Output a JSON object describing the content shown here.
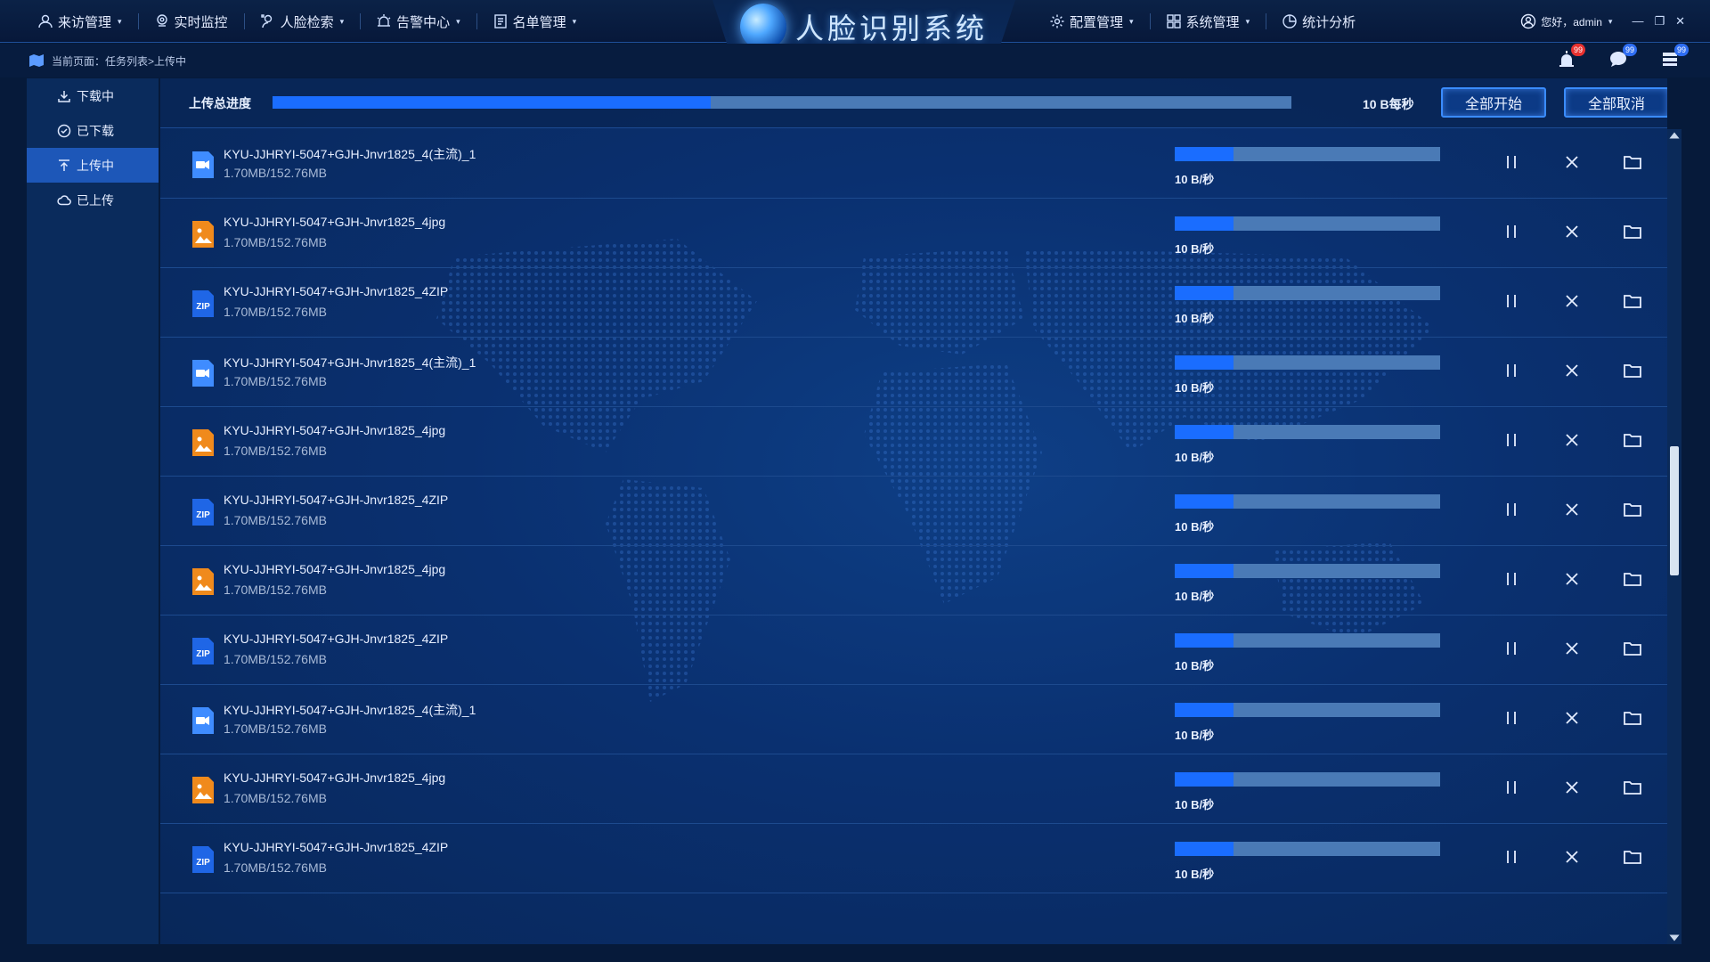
{
  "nav": {
    "left": [
      {
        "label": "来访管理",
        "icon": "user-icon",
        "caret": true
      },
      {
        "label": "实时监控",
        "icon": "location-icon",
        "caret": false
      },
      {
        "label": "人脸检索",
        "icon": "face-search-icon",
        "caret": true
      },
      {
        "label": "告警中心",
        "icon": "alarm-icon",
        "caret": true
      },
      {
        "label": "名单管理",
        "icon": "list-icon",
        "caret": true
      }
    ],
    "right": [
      {
        "label": "配置管理",
        "icon": "gear-icon",
        "caret": true
      },
      {
        "label": "系统管理",
        "icon": "grid-icon",
        "caret": true
      },
      {
        "label": "统计分析",
        "icon": "pie-icon",
        "caret": false
      }
    ],
    "brand_title": "人脸识别系统",
    "user_greeting": "您好，admin",
    "caret_char": "▾",
    "window_controls": {
      "minimize": "—",
      "restore": "❐",
      "close": "✕"
    }
  },
  "breadcrumb": {
    "text": "当前页面：任务列表>上传中"
  },
  "tool_badges": {
    "alarm": "99",
    "message": "99",
    "task": "99"
  },
  "sidebar": {
    "items": [
      {
        "label": "下载中",
        "icon": "download-icon",
        "active": false
      },
      {
        "label": "已下载",
        "icon": "check-circle-icon",
        "active": false
      },
      {
        "label": "上传中",
        "icon": "upload-icon",
        "active": true
      },
      {
        "label": "已上传",
        "icon": "cloud-icon",
        "active": false
      }
    ]
  },
  "upload_total": {
    "label": "上传总进度",
    "progress_percent": 43,
    "speed": "10 B每秒",
    "start_all": "全部开始",
    "cancel_all": "全部取消"
  },
  "files": [
    {
      "name": "KYU-JJHRYI-5047+GJH-Jnvr1825_4(主流)_1",
      "size": "1.70MB/152.76MB",
      "type": "video",
      "progress_percent": 22,
      "speed": "10 B/秒"
    },
    {
      "name": "KYU-JJHRYI-5047+GJH-Jnvr1825_4jpg",
      "size": "1.70MB/152.76MB",
      "type": "image",
      "progress_percent": 22,
      "speed": "10 B/秒"
    },
    {
      "name": "KYU-JJHRYI-5047+GJH-Jnvr1825_4ZIP",
      "size": "1.70MB/152.76MB",
      "type": "zip",
      "progress_percent": 22,
      "speed": "10 B/秒"
    },
    {
      "name": "KYU-JJHRYI-5047+GJH-Jnvr1825_4(主流)_1",
      "size": "1.70MB/152.76MB",
      "type": "video",
      "progress_percent": 22,
      "speed": "10 B/秒"
    },
    {
      "name": "KYU-JJHRYI-5047+GJH-Jnvr1825_4jpg",
      "size": "1.70MB/152.76MB",
      "type": "image",
      "progress_percent": 22,
      "speed": "10 B/秒"
    },
    {
      "name": "KYU-JJHRYI-5047+GJH-Jnvr1825_4ZIP",
      "size": "1.70MB/152.76MB",
      "type": "zip",
      "progress_percent": 22,
      "speed": "10 B/秒"
    },
    {
      "name": "KYU-JJHRYI-5047+GJH-Jnvr1825_4jpg",
      "size": "1.70MB/152.76MB",
      "type": "image",
      "progress_percent": 22,
      "speed": "10 B/秒"
    },
    {
      "name": "KYU-JJHRYI-5047+GJH-Jnvr1825_4ZIP",
      "size": "1.70MB/152.76MB",
      "type": "zip",
      "progress_percent": 22,
      "speed": "10 B/秒"
    },
    {
      "name": "KYU-JJHRYI-5047+GJH-Jnvr1825_4(主流)_1",
      "size": "1.70MB/152.76MB",
      "type": "video",
      "progress_percent": 22,
      "speed": "10 B/秒"
    },
    {
      "name": "KYU-JJHRYI-5047+GJH-Jnvr1825_4jpg",
      "size": "1.70MB/152.76MB",
      "type": "image",
      "progress_percent": 22,
      "speed": "10 B/秒"
    },
    {
      "name": "KYU-JJHRYI-5047+GJH-Jnvr1825_4ZIP",
      "size": "1.70MB/152.76MB",
      "type": "zip",
      "progress_percent": 22,
      "speed": "10 B/秒"
    }
  ],
  "icons": {
    "zip_label": "ZIP"
  },
  "colors": {
    "accent": "#1a6dff",
    "video_icon": "#3f8cff",
    "image_icon": "#f08a1c",
    "zip_icon": "#1f66e6",
    "badge_red": "#e8312f"
  }
}
